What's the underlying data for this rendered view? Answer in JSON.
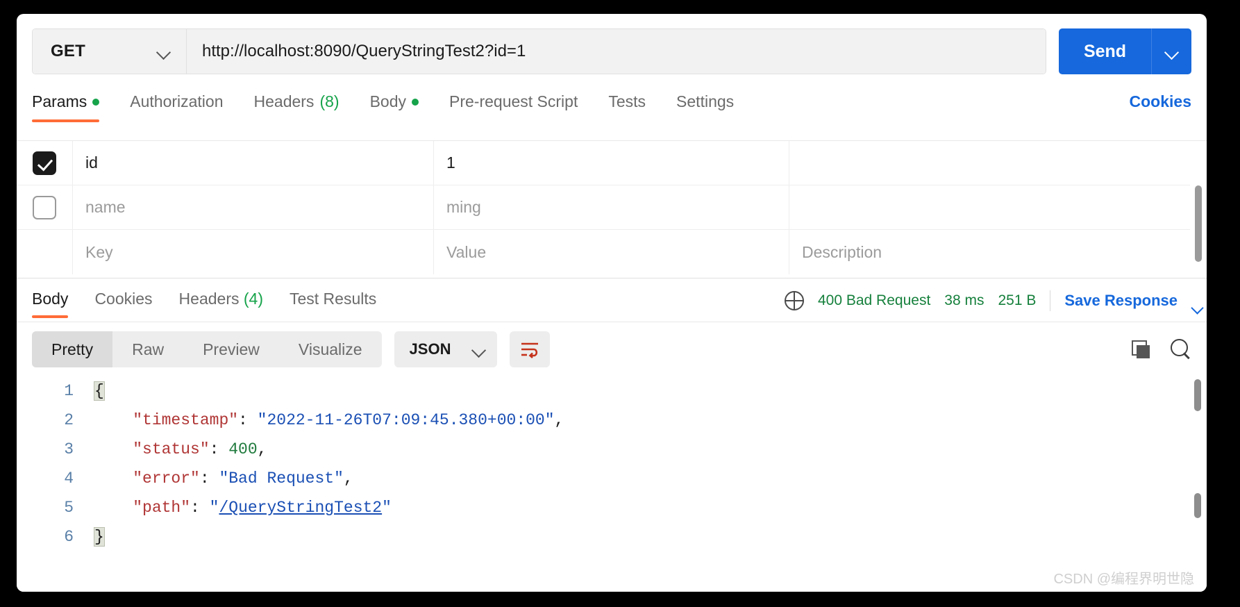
{
  "request": {
    "method": "GET",
    "url": "http://localhost:8090/QueryStringTest2?id=1",
    "send_label": "Send",
    "tabs": [
      {
        "label": "Params",
        "badge_dot": true,
        "count": "",
        "active": true
      },
      {
        "label": "Authorization",
        "badge_dot": false,
        "count": "",
        "active": false
      },
      {
        "label": "Headers",
        "badge_dot": false,
        "count": "(8)",
        "active": false
      },
      {
        "label": "Body",
        "badge_dot": true,
        "count": "",
        "active": false
      },
      {
        "label": "Pre-request Script",
        "badge_dot": false,
        "count": "",
        "active": false
      },
      {
        "label": "Tests",
        "badge_dot": false,
        "count": "",
        "active": false
      },
      {
        "label": "Settings",
        "badge_dot": false,
        "count": "",
        "active": false
      }
    ],
    "cookies_link": "Cookies"
  },
  "params_table": {
    "placeholders": {
      "key": "Key",
      "value": "Value",
      "description": "Description"
    },
    "rows": [
      {
        "checked": true,
        "key": "id",
        "value": "1",
        "description": "",
        "muted": false
      },
      {
        "checked": false,
        "key": "name",
        "value": "ming",
        "description": "",
        "muted": true
      },
      {
        "checked": null,
        "key": "Key",
        "value": "Value",
        "description": "Description",
        "muted": true
      }
    ]
  },
  "response": {
    "tabs": [
      {
        "label": "Body",
        "count": "",
        "active": true
      },
      {
        "label": "Cookies",
        "count": "",
        "active": false
      },
      {
        "label": "Headers",
        "count": "(4)",
        "active": false
      },
      {
        "label": "Test Results",
        "count": "",
        "active": false
      }
    ],
    "status_text": "400 Bad Request",
    "time_text": "38 ms",
    "size_text": "251 B",
    "save_response": "Save Response",
    "view_modes": [
      {
        "label": "Pretty",
        "active": true
      },
      {
        "label": "Raw",
        "active": false
      },
      {
        "label": "Preview",
        "active": false
      },
      {
        "label": "Visualize",
        "active": false
      }
    ],
    "format": "JSON",
    "body_lines": [
      {
        "no": "1",
        "segments": [
          {
            "t": "{",
            "c": "brace-hl jpunc"
          }
        ]
      },
      {
        "no": "2",
        "segments": [
          {
            "t": "    ",
            "c": "jpunc"
          },
          {
            "t": "\"timestamp\"",
            "c": "jkey"
          },
          {
            "t": ": ",
            "c": "jpunc"
          },
          {
            "t": "\"2022-11-26T07:09:45.380+00:00\"",
            "c": "jstr"
          },
          {
            "t": ",",
            "c": "jpunc"
          }
        ]
      },
      {
        "no": "3",
        "segments": [
          {
            "t": "    ",
            "c": "jpunc"
          },
          {
            "t": "\"status\"",
            "c": "jkey"
          },
          {
            "t": ": ",
            "c": "jpunc"
          },
          {
            "t": "400",
            "c": "jnum"
          },
          {
            "t": ",",
            "c": "jpunc"
          }
        ]
      },
      {
        "no": "4",
        "segments": [
          {
            "t": "    ",
            "c": "jpunc"
          },
          {
            "t": "\"error\"",
            "c": "jkey"
          },
          {
            "t": ": ",
            "c": "jpunc"
          },
          {
            "t": "\"Bad Request\"",
            "c": "jstr"
          },
          {
            "t": ",",
            "c": "jpunc"
          }
        ]
      },
      {
        "no": "5",
        "segments": [
          {
            "t": "    ",
            "c": "jpunc"
          },
          {
            "t": "\"path\"",
            "c": "jkey"
          },
          {
            "t": ": ",
            "c": "jpunc"
          },
          {
            "t": "\"",
            "c": "jstr"
          },
          {
            "t": "/QueryStringTest2",
            "c": "jlink"
          },
          {
            "t": "\"",
            "c": "jstr"
          }
        ]
      },
      {
        "no": "6",
        "segments": [
          {
            "t": "}",
            "c": "brace-hl jpunc"
          }
        ]
      }
    ]
  },
  "watermark": "CSDN @编程界明世隐",
  "colors": {
    "accent_orange": "#ff6c37",
    "send_blue": "#1668dc",
    "status_green": "#16803c",
    "dot_green": "#16a34a"
  }
}
